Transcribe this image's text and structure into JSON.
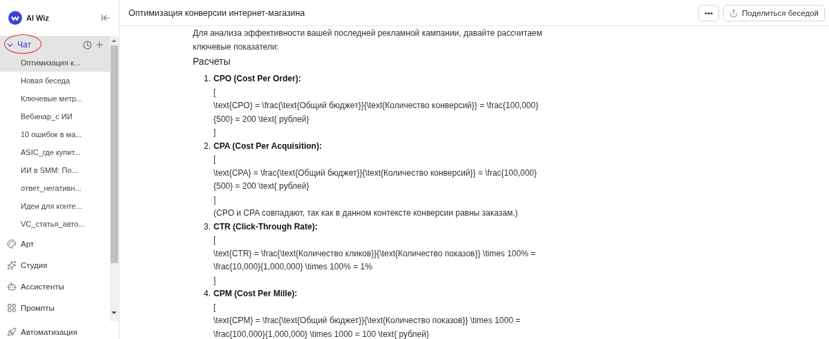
{
  "sidebar": {
    "logo": "AI Wiz",
    "chat": {
      "label": "Чат",
      "expanded": true,
      "annotated": true,
      "items": [
        {
          "label": "Оптимизация к...",
          "selected": true
        },
        {
          "label": "Новая беседа",
          "selected": false
        },
        {
          "label": "Ключевые метр...",
          "selected": false
        },
        {
          "label": "Вебинар_с ИИ",
          "selected": false
        },
        {
          "label": "10 ошибок в ма...",
          "selected": false
        },
        {
          "label": "ASIC_где купит...",
          "selected": false
        },
        {
          "label": "ИИ в SMM: По...",
          "selected": false
        },
        {
          "label": "ответ_негативн...",
          "selected": false
        },
        {
          "label": "Идеи для конте...",
          "selected": false
        },
        {
          "label": "VC_статья_авто...",
          "selected": false
        }
      ]
    },
    "nav": [
      {
        "label": "Арт",
        "kind": "art"
      },
      {
        "label": "Студия",
        "kind": "studio"
      },
      {
        "label": "Ассистенты",
        "kind": "assistants"
      },
      {
        "label": "Промпты",
        "kind": "prompts"
      }
    ],
    "bottom": {
      "label": "Автоматизация",
      "kind": "automation"
    }
  },
  "header": {
    "title": "Оптимизация конверсии интернет-магазина",
    "more": "•••",
    "share": "Поделиться беседой"
  },
  "message": {
    "intro": [
      "Для анализа эффективности вашей последней рекламной кампании, давайте рассчитаем",
      "ключевые показатели:"
    ],
    "heading": "Расчеты",
    "items": [
      {
        "number": "1.",
        "title": "CPO (Cost Per Order):",
        "lines": [
          "[",
          "\\text{CPO} = \\frac{\\text{Общий бюджет}}{\\text{Количество конверсий}} = \\frac{100,000}",
          "{500} = 200 \\text{ рублей}",
          "]"
        ]
      },
      {
        "number": "2.",
        "title": "CPA (Cost Per Acquisition):",
        "lines": [
          "[",
          "\\text{CPA} = \\frac{\\text{Общий бюджет}}{\\text{Количество конверсий}} = \\frac{100,000}",
          "{500} = 200 \\text{ рублей}",
          "]",
          "(CPO и CPA совпадают, так как в данном контексте конверсии равны заказам.)"
        ]
      },
      {
        "number": "3.",
        "title": "CTR (Click-Through Rate):",
        "lines": [
          "[",
          "\\text{CTR} = \\frac{\\text{Количество кликов}}{\\text{Количество показов}} \\times 100% =",
          "\\frac{10,000}{1,000,000} \\times 100% = 1%",
          "]"
        ]
      },
      {
        "number": "4.",
        "title": "CPM (Cost Per Mille):",
        "lines": [
          "[",
          "\\text{CPM} = \\frac{\\text{Общий бюджет}}{\\text{Количество показов}} \\times 1000 =",
          "\\frac{100,000}{1,000,000} \\times 1000 = 100 \\text{ рублей}"
        ]
      }
    ]
  }
}
